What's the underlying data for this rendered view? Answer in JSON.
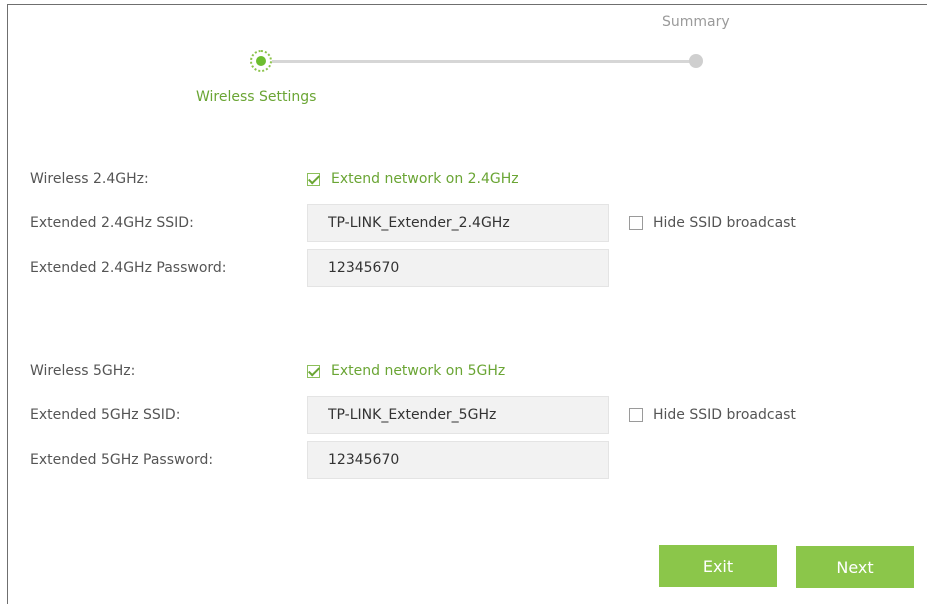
{
  "stepper": {
    "active_label": "Wireless Settings",
    "next_label": "Summary"
  },
  "band_24": {
    "wireless_label": "Wireless 2.4GHz:",
    "extend_checkbox_label": "Extend network on 2.4GHz",
    "extend_checked": true,
    "ssid_label": "Extended 2.4GHz SSID:",
    "ssid_value": "TP-LINK_Extender_2.4GHz",
    "hide_ssid_label": "Hide SSID broadcast",
    "hide_ssid_checked": false,
    "password_label": "Extended 2.4GHz Password:",
    "password_value": "12345670"
  },
  "band_5": {
    "wireless_label": "Wireless 5GHz:",
    "extend_checkbox_label": "Extend network on 5GHz",
    "extend_checked": true,
    "ssid_label": "Extended 5GHz SSID:",
    "ssid_value": "TP-LINK_Extender_5GHz",
    "hide_ssid_label": "Hide SSID broadcast",
    "hide_ssid_checked": false,
    "password_label": "Extended 5GHz Password:",
    "password_value": "12345670"
  },
  "buttons": {
    "exit_label": "Exit",
    "next_label": "Next"
  },
  "colors": {
    "accent_green": "#8bc64a",
    "active_text_green": "#6aa534",
    "input_background": "#f2f2f2"
  },
  "icons": {
    "active_step": "step-active-dot-icon",
    "next_step": "step-pending-dot-icon",
    "checked": "checkbox-checked-icon",
    "unchecked": "checkbox-unchecked-icon"
  }
}
